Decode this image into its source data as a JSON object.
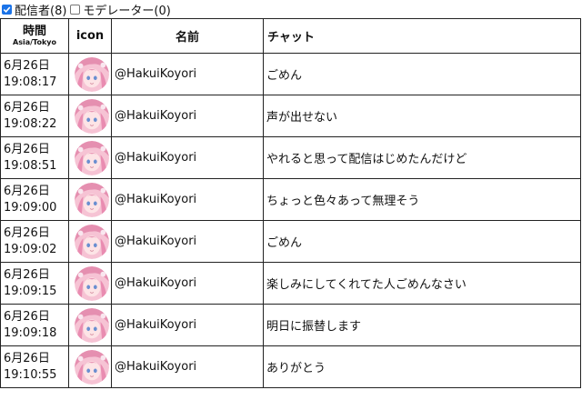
{
  "filters": [
    {
      "label": "配信者(8)",
      "checked": true
    },
    {
      "label": "モデレーター(0)",
      "checked": false
    }
  ],
  "table": {
    "headers": {
      "time_main": "時間",
      "time_sub": "Asia/Tokyo",
      "icon": "icon",
      "name": "名前",
      "chat": "チャット"
    },
    "rows": [
      {
        "date": "6月26日",
        "time": "19:08:17",
        "name": "@HakuiKoyori",
        "message": "ごめん"
      },
      {
        "date": "6月26日",
        "time": "19:08:22",
        "name": "@HakuiKoyori",
        "message": "声が出せない"
      },
      {
        "date": "6月26日",
        "time": "19:08:51",
        "name": "@HakuiKoyori",
        "message": "やれると思って配信はじめたんだけど"
      },
      {
        "date": "6月26日",
        "time": "19:09:00",
        "name": "@HakuiKoyori",
        "message": "ちょっと色々あって無理そう"
      },
      {
        "date": "6月26日",
        "time": "19:09:02",
        "name": "@HakuiKoyori",
        "message": "ごめん"
      },
      {
        "date": "6月26日",
        "time": "19:09:15",
        "name": "@HakuiKoyori",
        "message": "楽しみにしてくれてた人ごめんなさい"
      },
      {
        "date": "6月26日",
        "time": "19:09:18",
        "name": "@HakuiKoyori",
        "message": "明日に振替します"
      },
      {
        "date": "6月26日",
        "time": "19:10:55",
        "name": "@HakuiKoyori",
        "message": "ありがとう"
      }
    ]
  },
  "colors": {
    "checkbox_accent": "#1a73e8",
    "avatar_pink": "#f2a9c2"
  }
}
